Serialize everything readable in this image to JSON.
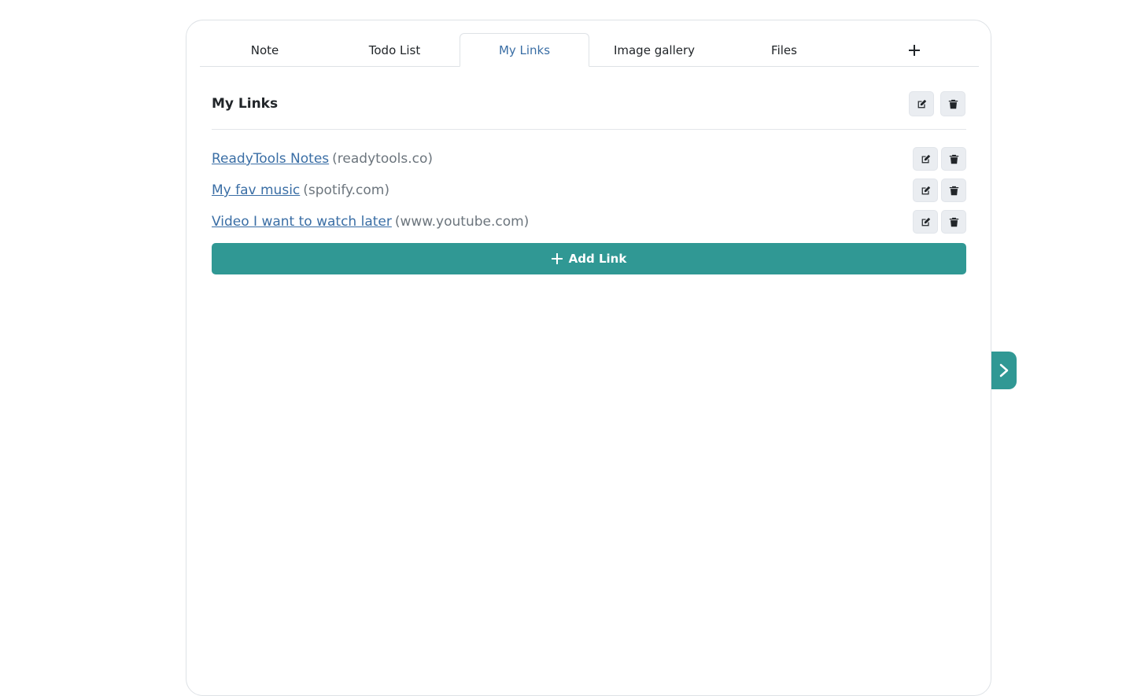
{
  "tabs": [
    {
      "label": "Note"
    },
    {
      "label": "Todo List"
    },
    {
      "label": "My Links",
      "active": true
    },
    {
      "label": "Image gallery"
    },
    {
      "label": "Files"
    }
  ],
  "add_tab_icon": "plus-icon",
  "section": {
    "title": "My Links"
  },
  "links": [
    {
      "title": "ReadyTools Notes",
      "domain": "(readytools.co)"
    },
    {
      "title": "My fav music",
      "domain": "(spotify.com)"
    },
    {
      "title": "Video I want to watch later",
      "domain": "(www.youtube.com)"
    }
  ],
  "add_link_label": "Add Link",
  "colors": {
    "accent": "#309894",
    "link": "#3a6ea5"
  }
}
